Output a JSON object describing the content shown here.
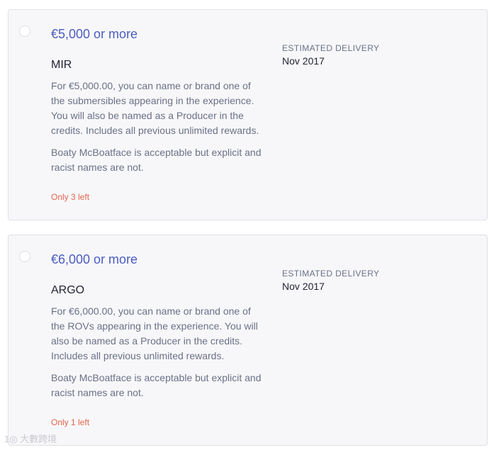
{
  "delivery_label": "ESTIMATED DELIVERY",
  "rewards": [
    {
      "price": "€5,000 or more",
      "title": "MIR",
      "description": "For €5,000.00, you can name or brand one of the submersibles appearing in the experience. You will also be named as a Producer in the credits. Includes all previous unlimited rewards.",
      "note": "Boaty McBoatface is acceptable but explicit and racist names are not.",
      "availability": "Only 3 left",
      "delivery_date": "Nov 2017"
    },
    {
      "price": "€6,000 or more",
      "title": "ARGO",
      "description": "For €6,000.00, you can name or brand one of the ROVs appearing in the experience. You will also be named as a Producer in the credits. Includes all previous unlimited rewards.",
      "note": "Boaty McBoatface is acceptable but explicit and racist names are not.",
      "availability": "Only 1 left",
      "delivery_date": "Nov 2017"
    }
  ],
  "watermark": "1◎ 大數跨境",
  "colors": {
    "price": "#4a5cc0",
    "availability": "#e3644a",
    "card_background": "#f7f7fa",
    "card_border": "#dfe0e6"
  }
}
